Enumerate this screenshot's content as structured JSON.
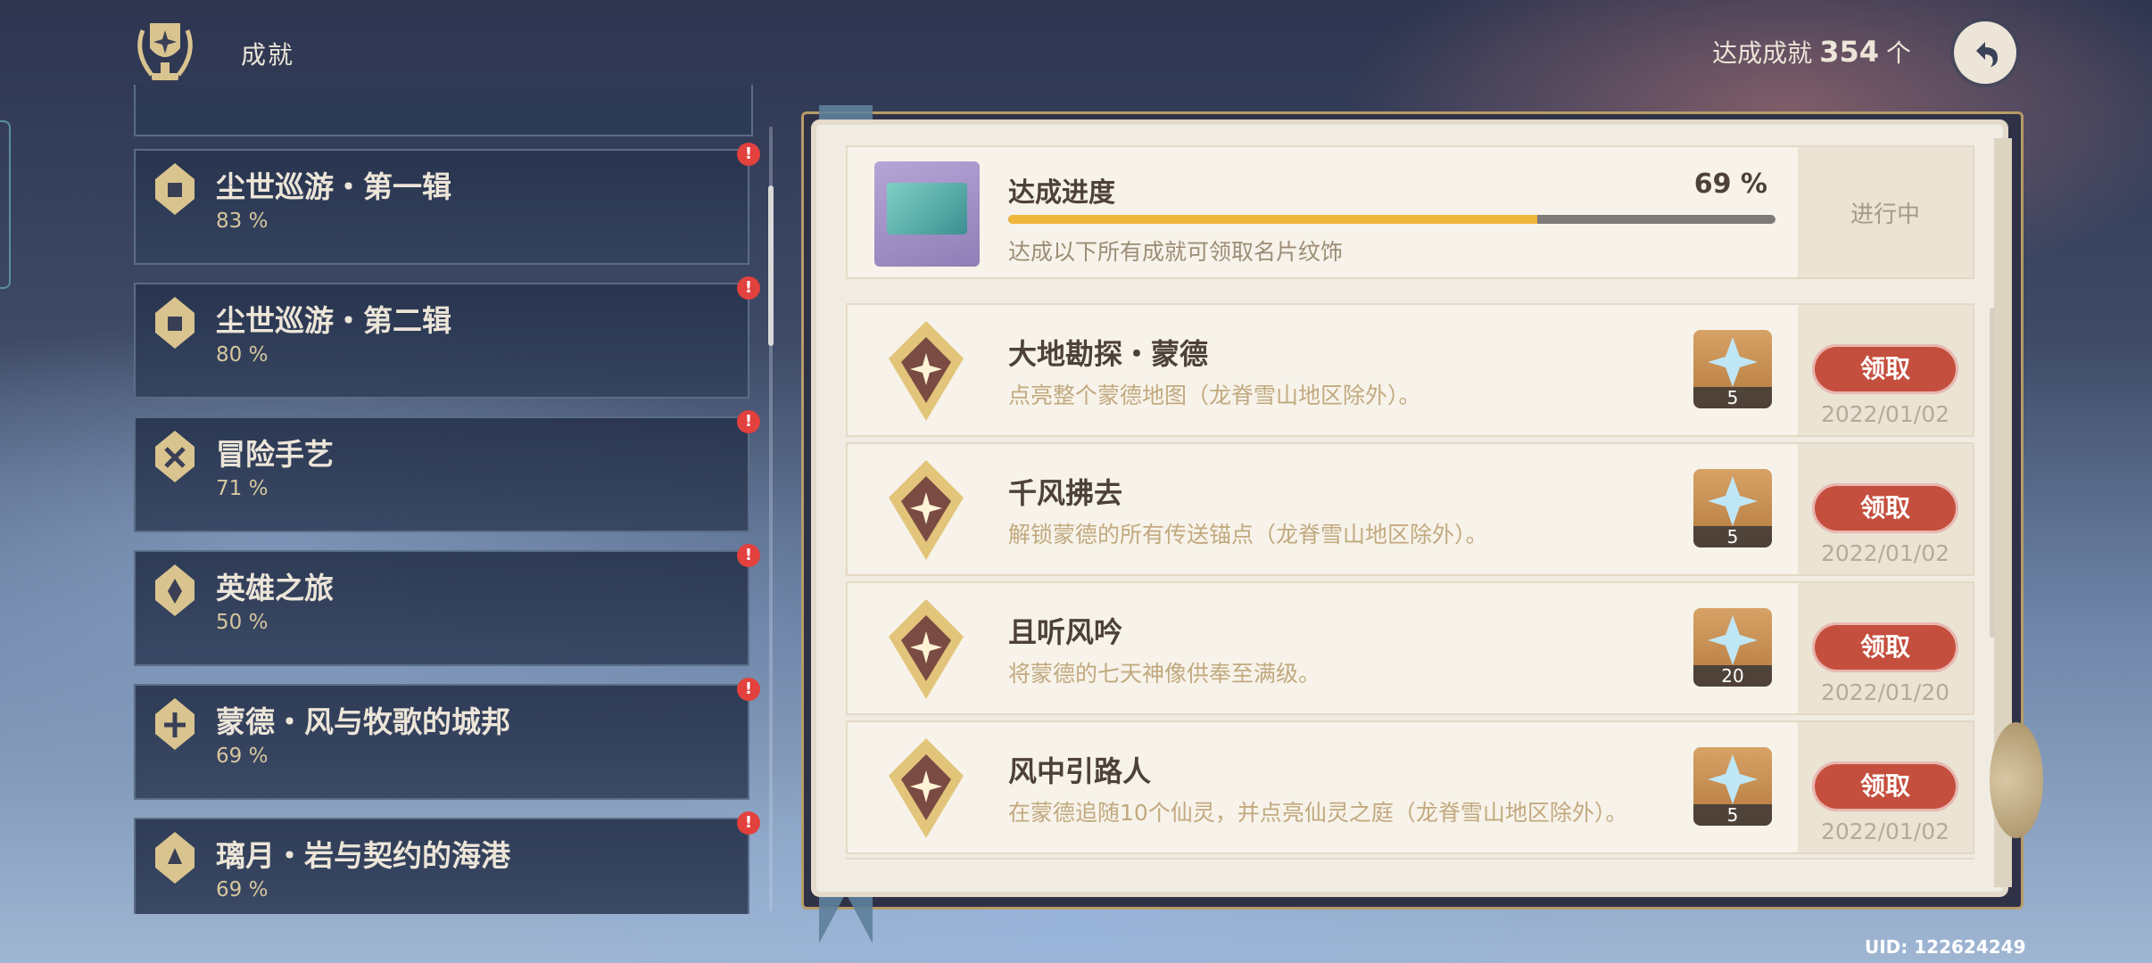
{
  "header": {
    "title": "成就",
    "total_label": "达成成就",
    "total_count": "354",
    "total_unit": "个"
  },
  "categories": [
    {
      "name": "尘世巡游・第一辑",
      "pct": "83 %"
    },
    {
      "name": "尘世巡游・第二辑",
      "pct": "80 %"
    },
    {
      "name": "冒险手艺",
      "pct": "71 %"
    },
    {
      "name": "英雄之旅",
      "pct": "50 %"
    },
    {
      "name": "蒙德・风与牧歌的城邦",
      "pct": "69 %"
    },
    {
      "name": "璃月・岩与契约的海港",
      "pct": "69 %"
    }
  ],
  "notification_mark": "!",
  "progress": {
    "label": "达成进度",
    "pct": "69 %",
    "fill_fraction": 0.69,
    "desc": "达成以下所有成就可领取名片纹饰",
    "status": "进行中"
  },
  "achievements": [
    {
      "title": "大地勘探・蒙德",
      "desc": "点亮整个蒙德地图（龙脊雪山地区除外）。",
      "reward": "5",
      "button": "领取",
      "date": "2022/01/02"
    },
    {
      "title": "千风拂去",
      "desc": "解锁蒙德的所有传送锚点（龙脊雪山地区除外）。",
      "reward": "5",
      "button": "领取",
      "date": "2022/01/02"
    },
    {
      "title": "且听风吟",
      "desc": "将蒙德的七天神像供奉至满级。",
      "reward": "20",
      "button": "领取",
      "date": "2022/01/20"
    },
    {
      "title": "风中引路人",
      "desc": "在蒙德追随10个仙灵，并点亮仙灵之庭（龙脊雪山地区除外）。",
      "reward": "5",
      "button": "领取",
      "date": "2022/01/02"
    }
  ],
  "uid": "UID: 122624249",
  "colors": {
    "accent_gold": "#f0b53b",
    "claim_red": "#c54f3e",
    "badge_red": "#e2413e"
  }
}
